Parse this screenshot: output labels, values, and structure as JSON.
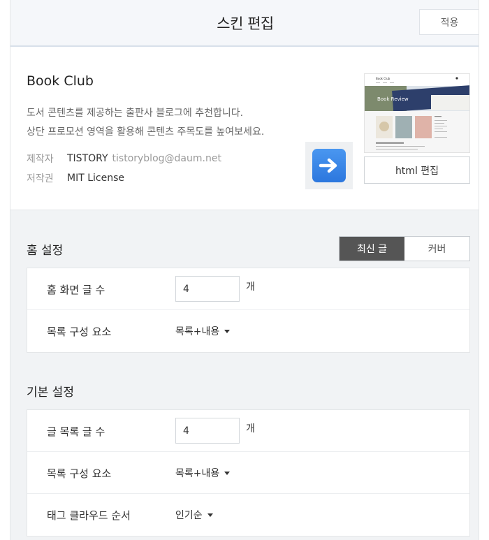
{
  "header": {
    "title": "스킨 편집",
    "apply_label": "적용"
  },
  "skin": {
    "name": "Book Club",
    "description_lines": [
      "도서 콘텐츠를 제공하는 출판사 블로그에 추천합니다.",
      "상단 프로모션 영역을 활용해 콘텐츠 주목도를 높여보세요."
    ],
    "author_label": "제작자",
    "author": "TISTORY",
    "author_email": "tistoryblog@daum.net",
    "license_label": "저작권",
    "license": "MIT License",
    "html_edit_label": "html 편집",
    "thumbnail": {
      "site_title": "Book Club",
      "banner_text": "Book Review"
    }
  },
  "home_settings": {
    "title": "홈 설정",
    "toggle": [
      {
        "label": "최신 글",
        "active": true
      },
      {
        "label": "커버",
        "active": false
      }
    ],
    "rows": {
      "post_count": {
        "label": "홈 화면 글 수",
        "value": "4",
        "unit": "개"
      },
      "list_element": {
        "label": "목록 구성 요소",
        "value": "목록+내용"
      }
    }
  },
  "basic_settings": {
    "title": "기본 설정",
    "rows": {
      "post_count": {
        "label": "글 목록 글 수",
        "value": "4",
        "unit": "개"
      },
      "list_element": {
        "label": "목록 구성 요소",
        "value": "목록+내용"
      },
      "tag_cloud_order": {
        "label": "태그 클라우드 순서",
        "value": "인기순"
      }
    }
  },
  "colors": {
    "accent_blue": "#2c77de",
    "toggle_active": "#555555",
    "panel_bg": "#f1f3f5"
  },
  "icons": {
    "arrow": "arrow-right-icon",
    "caret": "caret-down-icon"
  }
}
